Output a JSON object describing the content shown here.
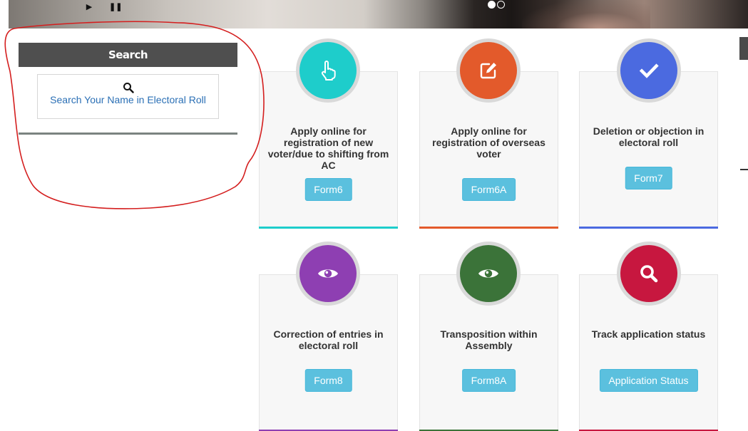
{
  "banner": {
    "play_icon": "play-icon",
    "pause_icon": "pause-icon",
    "play_glyph": "▶",
    "pause_glyph": "❚❚",
    "slides": 2,
    "active_slide": 1
  },
  "search": {
    "header": "Search",
    "icon": "search-icon",
    "link_label": "Search Your Name in Electoral Roll"
  },
  "cards": [
    {
      "title": "Apply online for registration of new voter/due to shifting from AC",
      "button": "Form6",
      "icon": "pointer-hand-icon",
      "color": "#1ecdcb"
    },
    {
      "title": "Apply online for registration of overseas voter",
      "button": "Form6A",
      "icon": "edit-icon",
      "color": "#e35a2b"
    },
    {
      "title": "Deletion or objection in electoral roll",
      "button": "Form7",
      "icon": "checkmark-icon",
      "color": "#4b6ae0"
    },
    {
      "title": "Correction of entries in electoral roll",
      "button": "Form8",
      "icon": "eye-icon",
      "color": "#8e3fb2"
    },
    {
      "title": "Transposition within Assembly",
      "button": "Form8A",
      "icon": "eye-icon",
      "color": "#3b7339"
    },
    {
      "title": "Track application status",
      "button": "Application Status",
      "icon": "search-icon",
      "color": "#c7173f"
    }
  ],
  "colors": {
    "button": "#5bc0de",
    "search_header": "#4f4f4f",
    "link": "#2a6fb5",
    "annotation": "#d41e1e"
  }
}
